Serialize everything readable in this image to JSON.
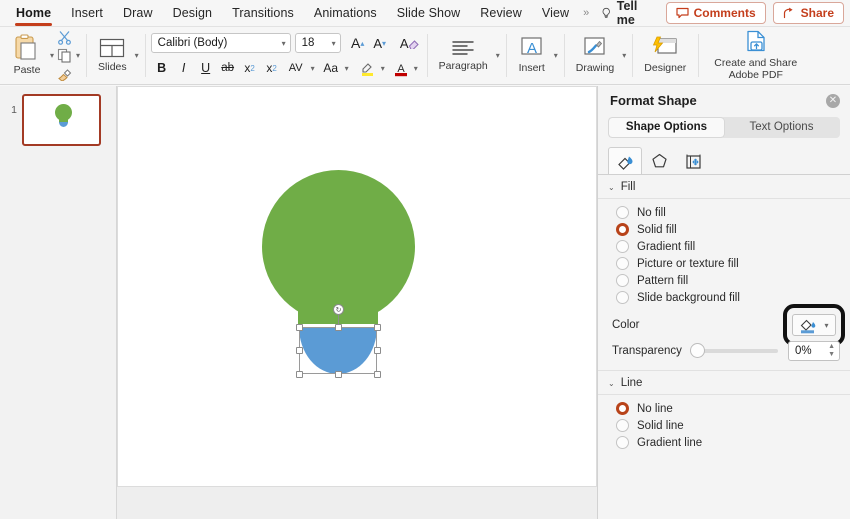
{
  "menubar": {
    "items": [
      {
        "label": "Home",
        "active": true
      },
      {
        "label": "Insert",
        "active": false
      },
      {
        "label": "Draw",
        "active": false
      },
      {
        "label": "Design",
        "active": false
      },
      {
        "label": "Transitions",
        "active": false
      },
      {
        "label": "Animations",
        "active": false
      },
      {
        "label": "Slide Show",
        "active": false
      },
      {
        "label": "Review",
        "active": false
      },
      {
        "label": "View",
        "active": false
      }
    ],
    "overflow_chevron": "»",
    "tell_me": "Tell me",
    "comments": "Comments",
    "share": "Share",
    "accent_color": "#c43e1c"
  },
  "ribbon": {
    "paste": "Paste",
    "cut_icon": "scissors-icon",
    "copy_icon": "copy-icon",
    "format_painter_icon": "format-painter-icon",
    "slides": "Slides",
    "font_name": "Calibri (Body)",
    "font_size": "18",
    "grow_font": "A",
    "shrink_font": "A",
    "clear_formatting": "A",
    "bold": "B",
    "italic": "I",
    "underline": "U",
    "strikethrough": "ab",
    "superscript": "x",
    "subscript": "x",
    "character_spacing": "AV",
    "change_case": "Aa",
    "text_highlight": "highlight-icon",
    "font_color": "font-color-icon",
    "paragraph": "Paragraph",
    "insert": "Insert",
    "drawing": "Drawing",
    "designer": "Designer",
    "adobe_pdf_line1": "Create and Share",
    "adobe_pdf_line2": "Adobe PDF"
  },
  "slide_panel": {
    "slide_number": "1",
    "thumbnail_name": "slide-thumbnail-1"
  },
  "canvas": {
    "shapes": [
      {
        "name": "bulb-top-circle",
        "color": "#70ad47"
      },
      {
        "name": "bulb-neck-rect",
        "color": "#70ad47"
      },
      {
        "name": "bulb-base-halfcircle",
        "color": "#5b9bd5",
        "selected": true
      }
    ],
    "rotation_handle_glyph": "↻"
  },
  "format_shape": {
    "title": "Format Shape",
    "close": "✕",
    "tabs": [
      {
        "label": "Shape Options",
        "selected": true
      },
      {
        "label": "Text Options",
        "selected": false
      }
    ],
    "icon_tabs": [
      {
        "name": "fill-and-line-icon",
        "selected": true
      },
      {
        "name": "effects-pentagon-icon",
        "selected": false
      },
      {
        "name": "size-and-properties-icon",
        "selected": false
      }
    ],
    "fill": {
      "section_label": "Fill",
      "collapse_glyph": "⌄",
      "options": [
        {
          "label": "No fill",
          "selected": false
        },
        {
          "label": "Solid fill",
          "selected": true
        },
        {
          "label": "Gradient fill",
          "selected": false
        },
        {
          "label": "Picture or texture fill",
          "selected": false
        },
        {
          "label": "Pattern fill",
          "selected": false
        },
        {
          "label": "Slide background fill",
          "selected": false
        }
      ],
      "color_label": "Color",
      "color_button_name": "fill-color-button",
      "color_swatch": "#5b9bd5",
      "transparency_label": "Transparency",
      "transparency_value": "0%"
    },
    "line": {
      "section_label": "Line",
      "collapse_glyph": "⌄",
      "options": [
        {
          "label": "No line",
          "selected": true
        },
        {
          "label": "Solid line",
          "selected": false
        },
        {
          "label": "Gradient line",
          "selected": false
        }
      ]
    },
    "selected_radio_color": "#b8431a"
  }
}
